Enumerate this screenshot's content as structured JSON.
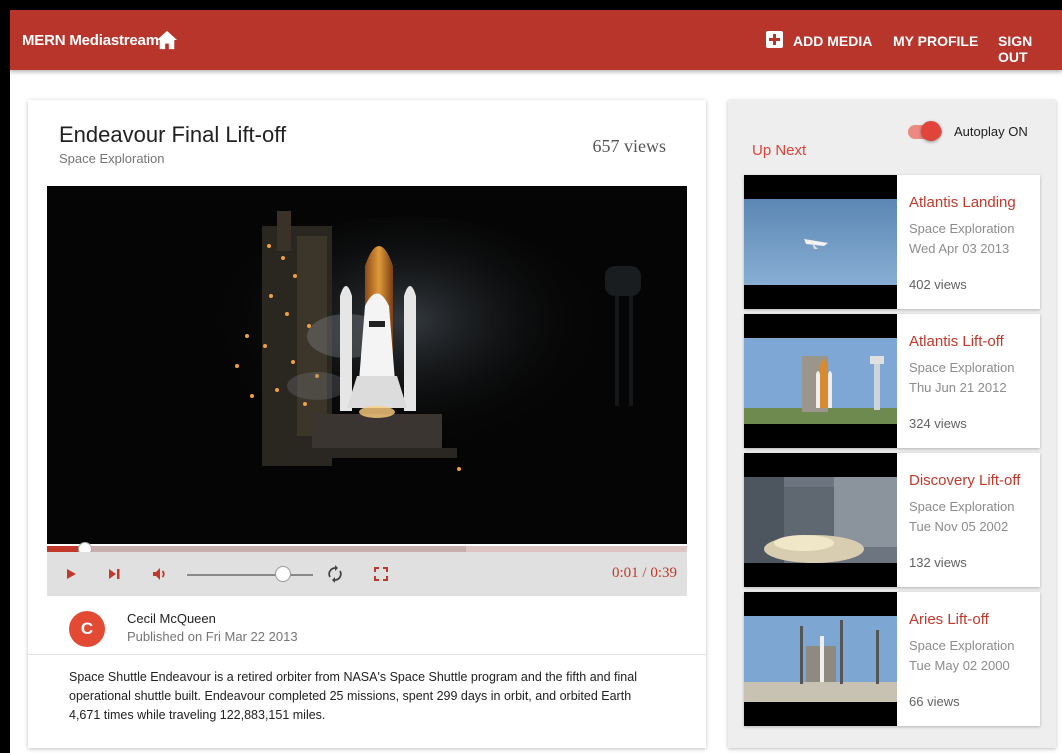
{
  "appbar": {
    "title": "MERN Mediastream",
    "add_media": "ADD MEDIA",
    "my_profile": "MY PROFILE",
    "sign_out": "SIGN OUT"
  },
  "media": {
    "title": "Endeavour Final Lift-off",
    "genre": "Space Exploration",
    "views": "657 views",
    "time": "0:01 / 0:39",
    "played_fraction": 0.06,
    "loaded_fraction": 0.655,
    "volume_fraction": 0.77,
    "author_initial": "C",
    "author_name": "Cecil McQueen",
    "published": "Published on Fri Mar 22 2013",
    "description": "Space Shuttle Endeavour is a retired orbiter from NASA's Space Shuttle program and the fifth and final operational shuttle built. Endeavour completed 25 missions, spent 299 days in orbit, and orbited Earth 4,671 times while traveling 122,883,151 miles."
  },
  "sidebar": {
    "heading": "Up Next",
    "autoplay_label": "Autoplay ON",
    "autoplay_on": true,
    "items": [
      {
        "title": "Atlantis Landing",
        "genre": "Space Exploration",
        "date": "Wed Apr 03 2013",
        "views": "402 views"
      },
      {
        "title": "Atlantis Lift-off",
        "genre": "Space Exploration",
        "date": "Thu Jun 21 2012",
        "views": "324 views"
      },
      {
        "title": "Discovery Lift-off",
        "genre": "Space Exploration",
        "date": "Tue Nov 05 2002",
        "views": "132 views"
      },
      {
        "title": "Aries Lift-off",
        "genre": "Space Exploration",
        "date": "Tue May 02 2000",
        "views": "66 views"
      }
    ]
  },
  "colors": {
    "primary": "#b7352b",
    "accent": "#e0443a",
    "title_red": "#c0392b"
  },
  "icons": [
    "home-icon",
    "add-box-icon",
    "play-icon",
    "skip-next-icon",
    "volume-icon",
    "loop-icon",
    "fullscreen-icon"
  ]
}
